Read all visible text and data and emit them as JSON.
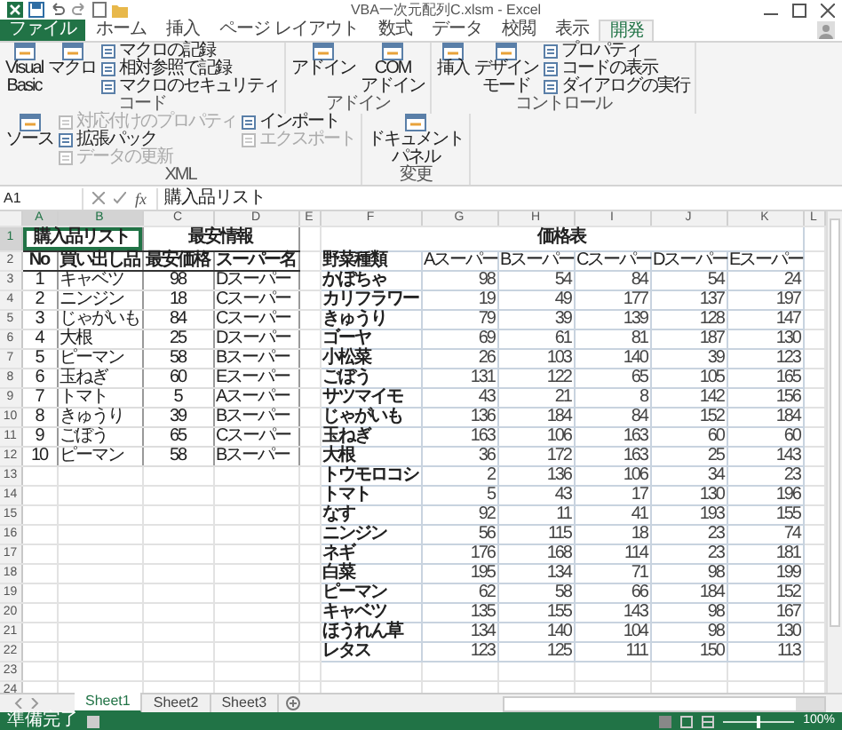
{
  "window": {
    "title": "VBA一次元配列C.xlsm - Excel"
  },
  "ribbon": {
    "tabs": [
      {
        "label": "ファイル",
        "selected": false,
        "kind": "file"
      },
      {
        "label": "ホーム",
        "selected": false,
        "kind": "tab"
      },
      {
        "label": "挿入",
        "selected": false,
        "kind": "tab"
      },
      {
        "label": "ページ レイアウト",
        "selected": false,
        "kind": "tab"
      },
      {
        "label": "数式",
        "selected": false,
        "kind": "tab"
      },
      {
        "label": "データ",
        "selected": false,
        "kind": "tab"
      },
      {
        "label": "校閲",
        "selected": false,
        "kind": "tab"
      },
      {
        "label": "表示",
        "selected": false,
        "kind": "tab"
      },
      {
        "label": "開発",
        "selected": true,
        "kind": "tab"
      }
    ],
    "groups": [
      {
        "name": "コード",
        "items": [
          {
            "lines": [
              "Visual",
              "Basic"
            ],
            "kind": "large",
            "disabled": false
          },
          {
            "lines": [
              "マクロ"
            ],
            "kind": "large",
            "disabled": false
          },
          {
            "label": "マクロの記録",
            "kind": "small",
            "disabled": false
          },
          {
            "label": "相対参照で記録",
            "kind": "small",
            "disabled": false
          },
          {
            "label": "マクロのセキュリティ",
            "kind": "small",
            "disabled": false
          }
        ]
      },
      {
        "name": "アドイン",
        "items": [
          {
            "lines": [
              "アドイン"
            ],
            "kind": "large",
            "disabled": false
          },
          {
            "lines": [
              "COM",
              "アドイン"
            ],
            "kind": "large",
            "disabled": false
          }
        ]
      },
      {
        "name": "コントロール",
        "items": [
          {
            "lines": [
              "挿入"
            ],
            "kind": "large",
            "disabled": false
          },
          {
            "lines": [
              "デザイン",
              "モード"
            ],
            "kind": "large",
            "disabled": false
          },
          {
            "label": "プロパティ",
            "kind": "small",
            "disabled": false
          },
          {
            "label": "コードの表示",
            "kind": "small",
            "disabled": false
          },
          {
            "label": "ダイアログの実行",
            "kind": "small",
            "disabled": false
          }
        ]
      },
      {
        "name": "XML",
        "items": [
          {
            "lines": [
              "ソース"
            ],
            "kind": "large",
            "disabled": false
          },
          {
            "label": "対応付けのプロパティ",
            "kind": "small",
            "disabled": true
          },
          {
            "label": "拡張パック",
            "kind": "small",
            "disabled": false
          },
          {
            "label": "データの更新",
            "kind": "small",
            "disabled": true
          },
          {
            "label": "インポート",
            "kind": "small",
            "disabled": false
          },
          {
            "label": "エクスポート",
            "kind": "small",
            "disabled": true
          }
        ]
      },
      {
        "name": "変更",
        "items": [
          {
            "lines": [
              "ドキュメント",
              "パネル"
            ],
            "kind": "large",
            "disabled": false
          }
        ]
      }
    ]
  },
  "formula_bar": {
    "cell_ref": "A1",
    "function_label": "fx",
    "formula": "購入品リスト"
  },
  "columns": [
    {
      "label": "A",
      "selected": true
    },
    {
      "label": "B",
      "selected": true
    },
    {
      "label": "C",
      "selected": false
    },
    {
      "label": "D",
      "selected": false
    },
    {
      "label": "E",
      "selected": false
    },
    {
      "label": "F",
      "selected": false
    },
    {
      "label": "G",
      "selected": false
    },
    {
      "label": "H",
      "selected": false
    },
    {
      "label": "I",
      "selected": false
    },
    {
      "label": "J",
      "selected": false
    },
    {
      "label": "K",
      "selected": false
    },
    {
      "label": "L",
      "selected": false
    }
  ],
  "row_numbers": [
    {
      "label": "1",
      "selected": true
    },
    {
      "label": "2",
      "selected": false
    },
    {
      "label": "3",
      "selected": false
    },
    {
      "label": "4",
      "selected": false
    },
    {
      "label": "5",
      "selected": false
    },
    {
      "label": "6",
      "selected": false
    },
    {
      "label": "7",
      "selected": false
    },
    {
      "label": "8",
      "selected": false
    },
    {
      "label": "9",
      "selected": false
    },
    {
      "label": "10",
      "selected": false
    },
    {
      "label": "11",
      "selected": false
    },
    {
      "label": "12",
      "selected": false
    },
    {
      "label": "13",
      "selected": false
    },
    {
      "label": "14",
      "selected": false
    },
    {
      "label": "15",
      "selected": false
    },
    {
      "label": "16",
      "selected": false
    },
    {
      "label": "17",
      "selected": false
    },
    {
      "label": "18",
      "selected": false
    },
    {
      "label": "19",
      "selected": false
    },
    {
      "label": "20",
      "selected": false
    },
    {
      "label": "21",
      "selected": false
    },
    {
      "label": "22",
      "selected": false
    },
    {
      "label": "23",
      "selected": false
    },
    {
      "label": "24",
      "selected": false
    }
  ],
  "purchase_table": {
    "title": "購入品リスト",
    "title_selected": true,
    "info_title": "最安情報",
    "headers": [
      "No",
      "買い出し品",
      "最安価格",
      "スーパー名"
    ],
    "rows": [
      [
        "1",
        "キャベツ",
        "98",
        "Dスーパー"
      ],
      [
        "2",
        "ニンジン",
        "18",
        "Cスーパー"
      ],
      [
        "3",
        "じゃがいも",
        "84",
        "Cスーパー"
      ],
      [
        "4",
        "大根",
        "25",
        "Dスーパー"
      ],
      [
        "5",
        "ピーマン",
        "58",
        "Bスーパー"
      ],
      [
        "6",
        "玉ねぎ",
        "60",
        "Eスーパー"
      ],
      [
        "7",
        "トマト",
        "5",
        "Aスーパー"
      ],
      [
        "8",
        "きゅうり",
        "39",
        "Bスーパー"
      ],
      [
        "9",
        "ごぼう",
        "65",
        "Cスーパー"
      ],
      [
        "10",
        "ピーマン",
        "58",
        "Bスーパー"
      ]
    ]
  },
  "price_table": {
    "title": "価格表",
    "headers": [
      "野菜種類",
      "Aスーパー",
      "Bスーパー",
      "Cスーパー",
      "Dスーパー",
      "Eスーパー"
    ],
    "rows": [
      {
        "name": "かぼちゃ",
        "values": [
          "98",
          "54",
          "84",
          "54",
          "24"
        ]
      },
      {
        "name": "カリフラワー",
        "values": [
          "19",
          "49",
          "177",
          "137",
          "197"
        ]
      },
      {
        "name": "きゅうり",
        "values": [
          "79",
          "39",
          "139",
          "128",
          "147"
        ]
      },
      {
        "name": "ゴーヤ",
        "values": [
          "69",
          "61",
          "81",
          "187",
          "130"
        ]
      },
      {
        "name": "小松菜",
        "values": [
          "26",
          "103",
          "140",
          "39",
          "123"
        ]
      },
      {
        "name": "ごぼう",
        "values": [
          "131",
          "122",
          "65",
          "105",
          "165"
        ]
      },
      {
        "name": "サツマイモ",
        "values": [
          "43",
          "21",
          "8",
          "142",
          "156"
        ]
      },
      {
        "name": "じゃがいも",
        "values": [
          "136",
          "184",
          "84",
          "152",
          "184"
        ]
      },
      {
        "name": "玉ねぎ",
        "values": [
          "163",
          "106",
          "163",
          "60",
          "60"
        ]
      },
      {
        "name": "大根",
        "values": [
          "36",
          "172",
          "163",
          "25",
          "143"
        ]
      },
      {
        "name": "トウモロコシ",
        "values": [
          "2",
          "136",
          "106",
          "34",
          "23"
        ]
      },
      {
        "name": "トマト",
        "values": [
          "5",
          "43",
          "17",
          "130",
          "196"
        ]
      },
      {
        "name": "なす",
        "values": [
          "92",
          "11",
          "41",
          "193",
          "155"
        ]
      },
      {
        "name": "ニンジン",
        "values": [
          "56",
          "115",
          "18",
          "23",
          "74"
        ]
      },
      {
        "name": "ネギ",
        "values": [
          "176",
          "168",
          "114",
          "23",
          "181"
        ]
      },
      {
        "name": "白菜",
        "values": [
          "195",
          "134",
          "71",
          "98",
          "199"
        ]
      },
      {
        "name": "ピーマン",
        "values": [
          "62",
          "58",
          "66",
          "184",
          "152"
        ]
      },
      {
        "name": "キャベツ",
        "values": [
          "135",
          "155",
          "143",
          "98",
          "167"
        ]
      },
      {
        "name": "ほうれん草",
        "values": [
          "134",
          "140",
          "104",
          "98",
          "130"
        ]
      },
      {
        "name": "レタス",
        "values": [
          "123",
          "125",
          "111",
          "150",
          "113"
        ]
      }
    ]
  },
  "sheet_tabs": [
    {
      "label": "Sheet1",
      "selected": true
    },
    {
      "label": "Sheet2",
      "selected": false
    },
    {
      "label": "Sheet3",
      "selected": false
    }
  ],
  "status_bar": {
    "status": "準備完了",
    "zoom": "100%",
    "level": 0.5
  }
}
